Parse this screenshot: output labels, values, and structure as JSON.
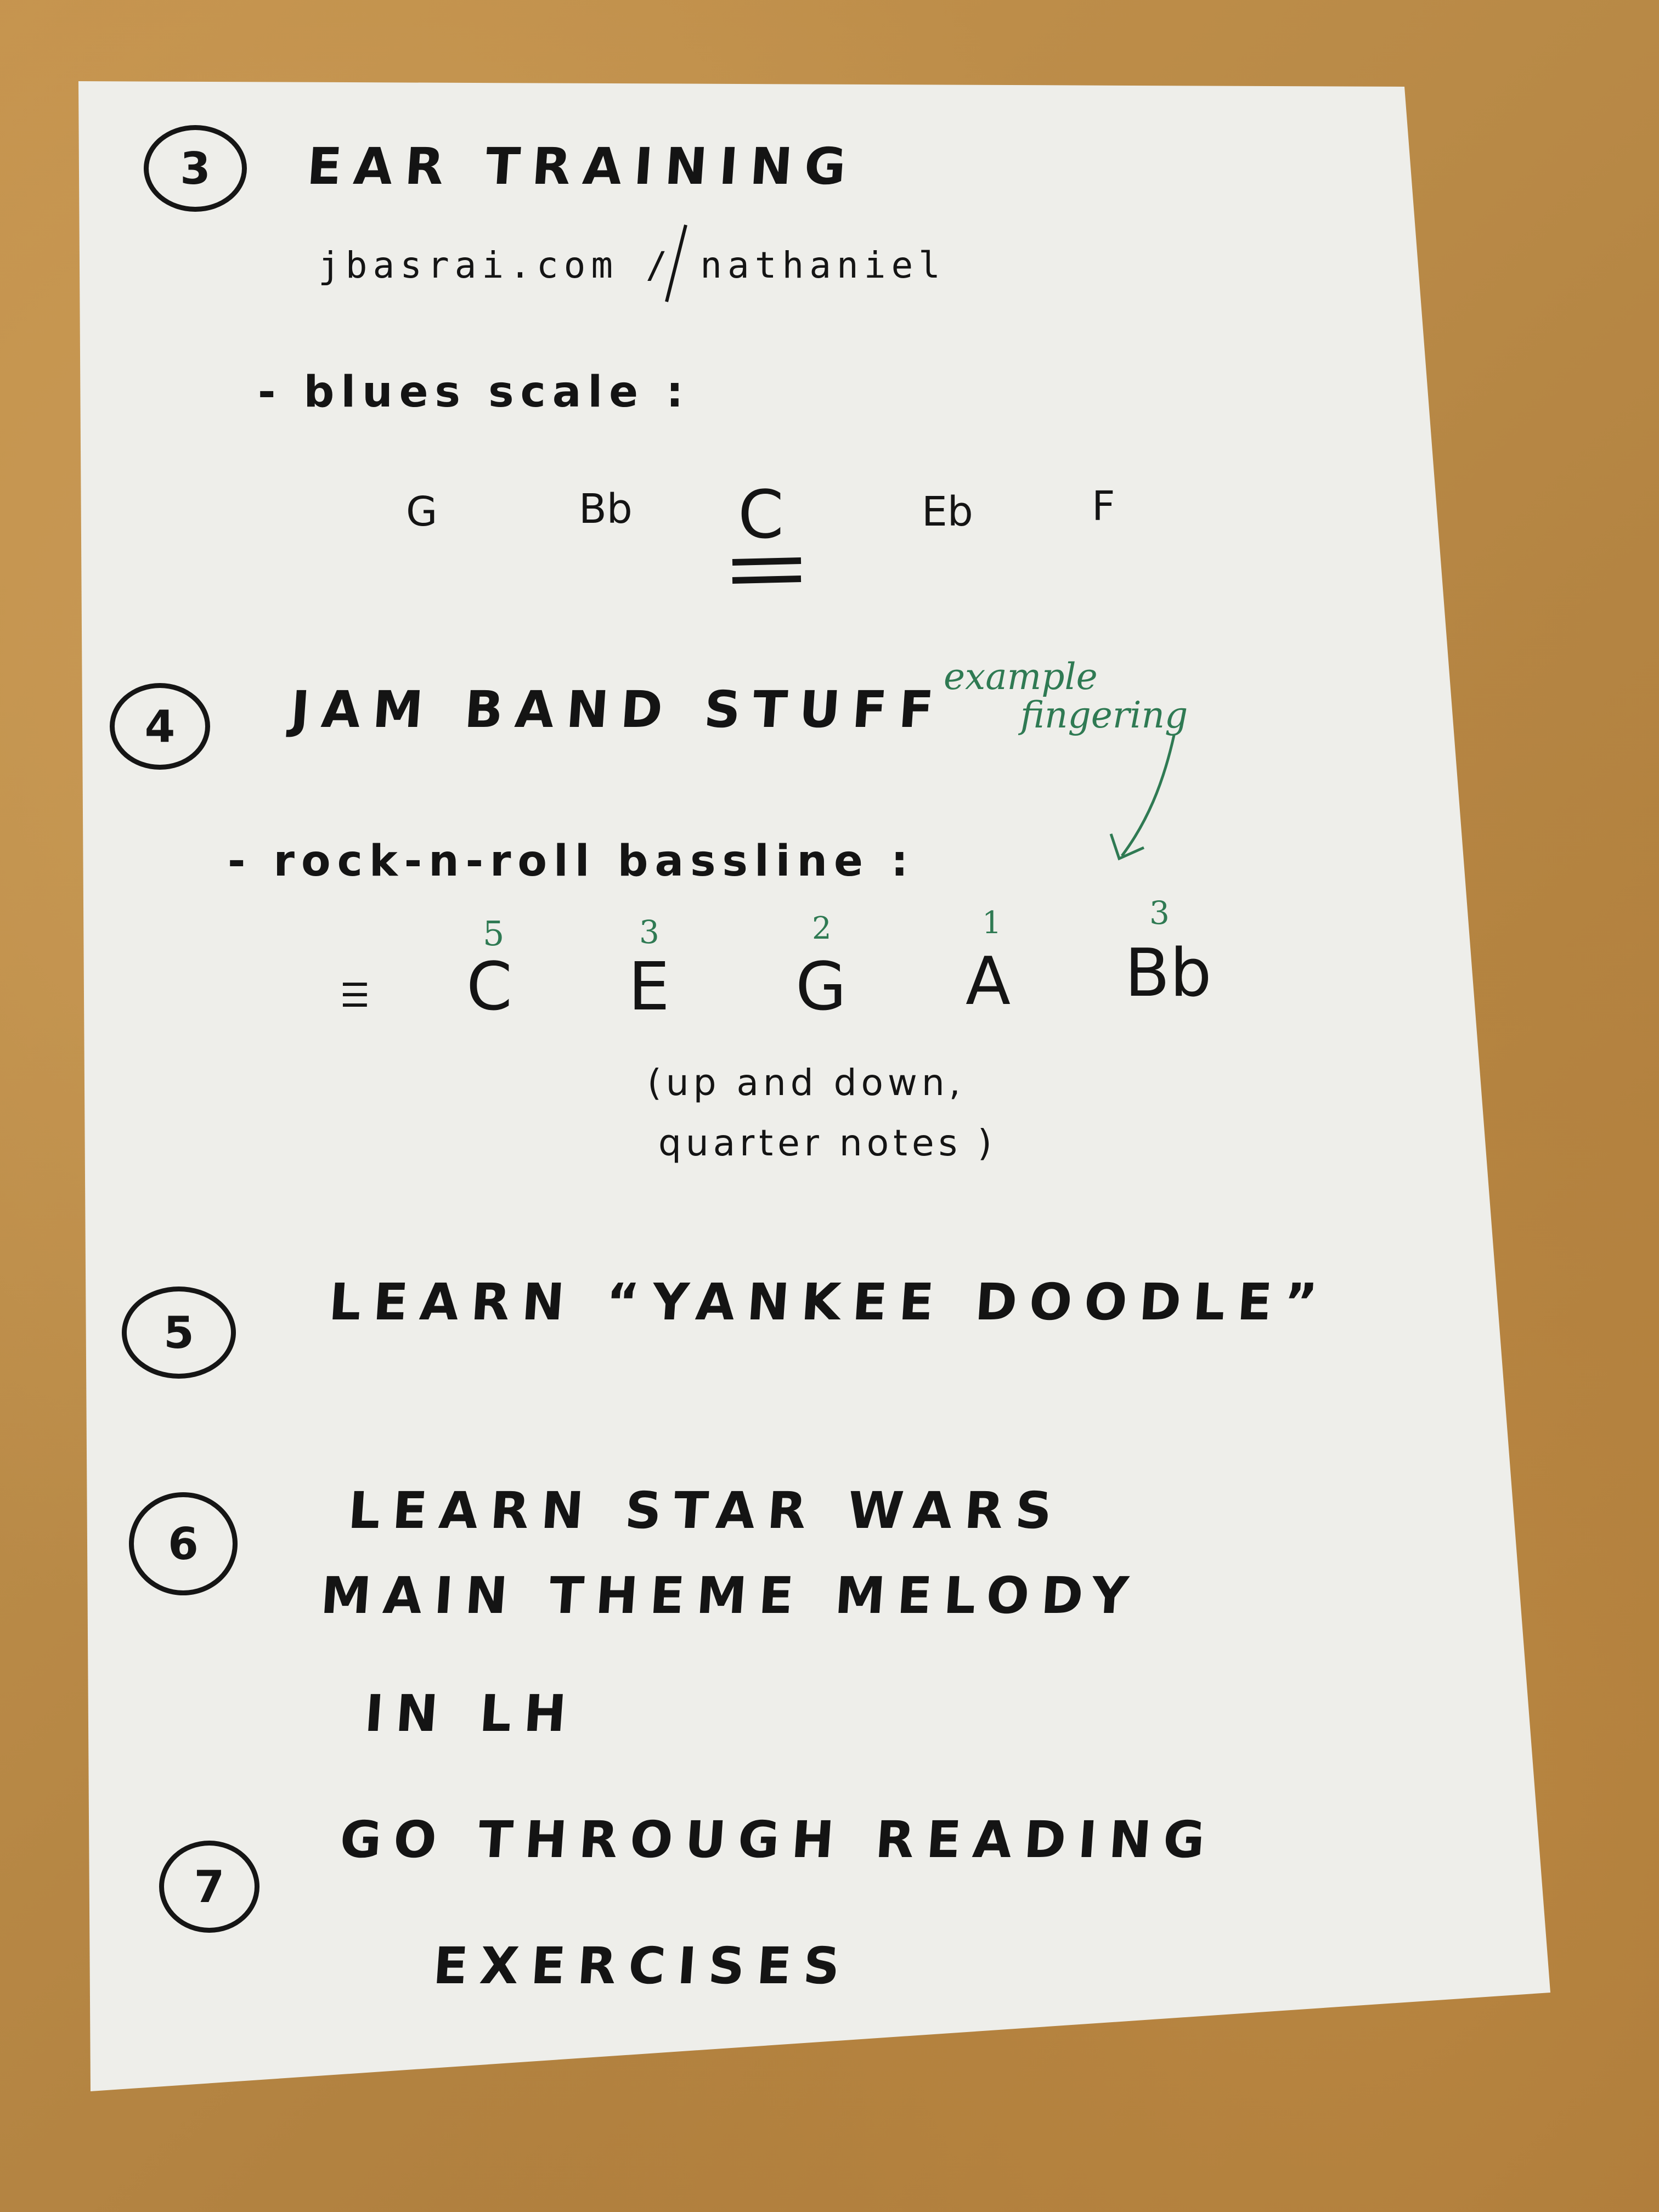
{
  "items": [
    {
      "number": "3",
      "title": "EAR TRAINING",
      "url": "jbasrai.com / nathaniel",
      "sub": "- blues scale :",
      "scale": [
        "G",
        "Bb",
        "C",
        "Eb",
        "F"
      ]
    },
    {
      "number": "4",
      "title": "JAM BAND STUFF",
      "annotation": [
        "example",
        "fingering"
      ],
      "sub": "- rock-n-roll bassline :",
      "clef_mark": "☰",
      "notes": [
        "C",
        "E",
        "G",
        "A",
        "Bb"
      ],
      "fingering": [
        "5",
        "3",
        "2",
        "1",
        "3"
      ],
      "remark": [
        "(up and down,",
        "quarter notes )"
      ]
    },
    {
      "number": "5",
      "title": "LEARN “YANKEE DOODLE”"
    },
    {
      "number": "6",
      "title_lines": [
        "LEARN STAR WARS",
        "MAIN THEME MELODY",
        "IN LH"
      ]
    },
    {
      "number": "7",
      "title_lines": [
        "GO THROUGH READING",
        "EXERCISES"
      ]
    }
  ],
  "colors": {
    "ink": "#141414",
    "green_ink": "#2f7a53",
    "paper": "#eeeeea",
    "desk": "#b98a47"
  }
}
